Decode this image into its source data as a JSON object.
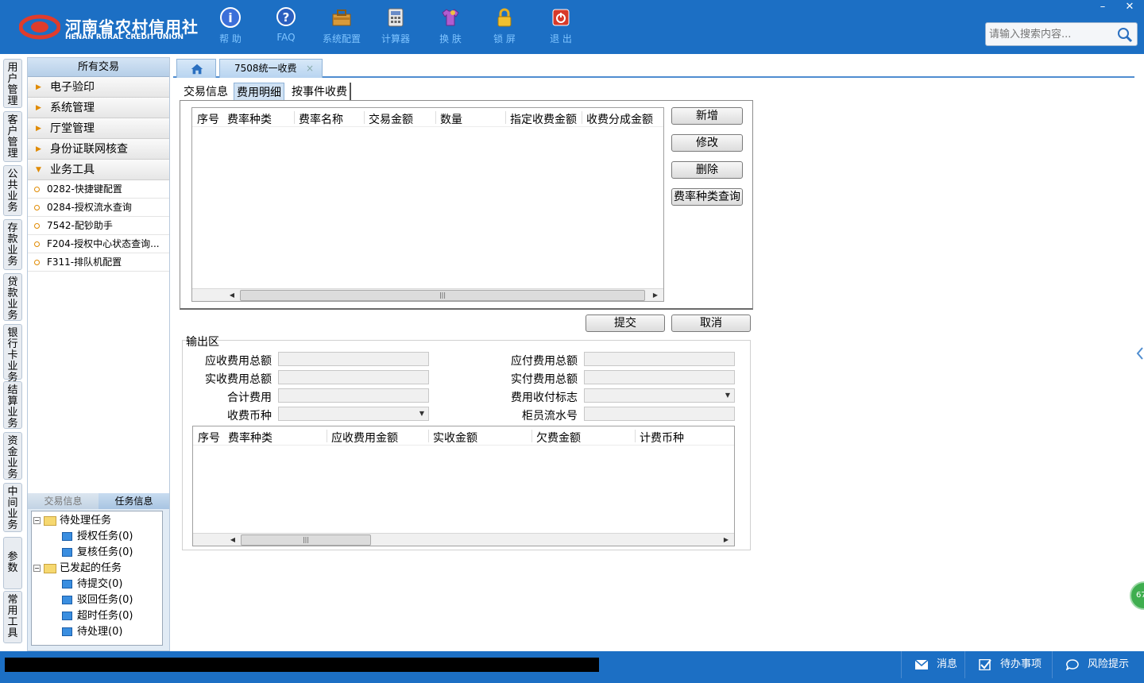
{
  "header": {
    "logo_cn": "河南省农村信用社",
    "logo_en": "HENAN RURAL CREDIT UNION",
    "tools": [
      {
        "label": "帮 助",
        "icon": "help-icon"
      },
      {
        "label": "FAQ",
        "icon": "faq-icon"
      },
      {
        "label": "系统配置",
        "icon": "toolbox-icon"
      },
      {
        "label": "计算器",
        "icon": "calculator-icon"
      },
      {
        "label": "换 肤",
        "icon": "tshirt-icon"
      },
      {
        "label": "锁 屏",
        "icon": "lock-icon"
      },
      {
        "label": "退 出",
        "icon": "power-icon"
      }
    ],
    "window_buttons": {
      "minimize": "–",
      "close": "✕"
    },
    "search_placeholder": "请输入搜索内容..."
  },
  "vtabs": [
    "用户管理",
    "客户管理",
    "公共业务",
    "存款业务",
    "贷款业务",
    "银行卡业务",
    "结算业务",
    "资金业务",
    "中间业务",
    "参数",
    "常用工具"
  ],
  "leftpanel": {
    "title": "所有交易",
    "categories": [
      "电子验印",
      "系统管理",
      "厅堂管理",
      "身份证联网核查",
      "业务工具"
    ],
    "subitems": [
      "0282-快捷键配置",
      "0284-授权流水查询",
      "7542-配钞助手",
      "F204-授权中心状态查询...",
      "F311-排队机配置"
    ],
    "task_tabs": [
      "交易信息",
      "任务信息"
    ],
    "tree": {
      "pending": "待处理任务",
      "pending_children": [
        "授权任务(0)",
        "复核任务(0)"
      ],
      "initiated": "已发起的任务",
      "initiated_children": [
        "待提交(0)",
        "驳回任务(0)",
        "超时任务(0)",
        "待处理(0)"
      ]
    }
  },
  "tabs": {
    "home_icon": "home-icon",
    "active_tab": "7508统一收费",
    "close": "×"
  },
  "inner_tabs": [
    "交易信息",
    "费用明细",
    "按事件收费"
  ],
  "fee_grid": {
    "columns": [
      "序号",
      "费率种类",
      "费率名称",
      "交易金额",
      "数量",
      "指定收费金额",
      "收费分成金额"
    ],
    "rows": []
  },
  "fee_buttons": {
    "add": "新增",
    "edit": "修改",
    "delete": "删除",
    "query": "费率种类查询"
  },
  "form_buttons": {
    "submit": "提交",
    "cancel": "取消"
  },
  "output": {
    "title": "输出区",
    "labels": {
      "receivable_total": "应收费用总额",
      "received_total": "实收费用总额",
      "fee_sum": "合计费用",
      "currency": "收费币种",
      "payable_total": "应付费用总额",
      "paid_total": "实付费用总额",
      "flag": "费用收付标志",
      "teller_serial": "柜员流水号"
    },
    "values": {
      "receivable_total": "",
      "received_total": "",
      "fee_sum": "",
      "currency": "",
      "payable_total": "",
      "paid_total": "",
      "flag": "",
      "teller_serial": ""
    }
  },
  "result_grid": {
    "columns": [
      "序号",
      "费率种类",
      "应收费用金额",
      "实收金额",
      "欠费金额",
      "计费币种"
    ],
    "rows": []
  },
  "float_ball": "67",
  "statusbar": {
    "message": "消息",
    "todo": "待办事项",
    "risk": "风险提示"
  },
  "colors": {
    "brand_blue": "#1c6fc4",
    "accent_orange": "#e08a00",
    "float_green": "#3fae4f"
  }
}
